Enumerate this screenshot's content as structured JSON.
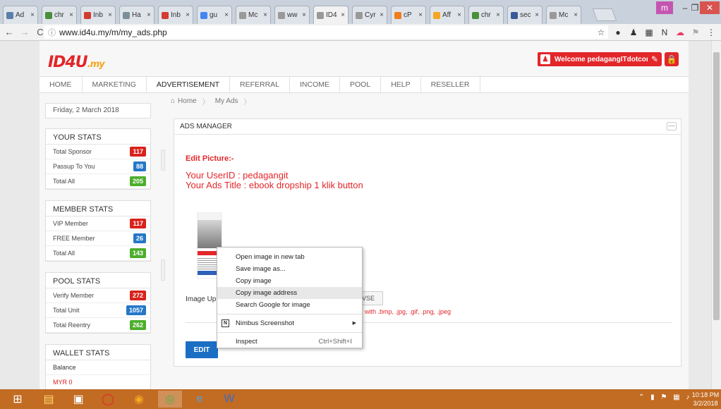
{
  "browser": {
    "tabs": [
      {
        "label": "Ad",
        "color": "#5a7fa8"
      },
      {
        "label": "chr",
        "color": "#4a8f3a"
      },
      {
        "label": "Inb",
        "color": "#d33b2f"
      },
      {
        "label": "Ha",
        "color": "#7b8f9a"
      },
      {
        "label": "Inb",
        "color": "#d33b2f"
      },
      {
        "label": "gu",
        "color": "#4285f4"
      },
      {
        "label": "Mc",
        "color": "#999999"
      },
      {
        "label": "ww",
        "color": "#999999"
      },
      {
        "label": "ID4",
        "color": "#999999",
        "active": true
      },
      {
        "label": "Cyr",
        "color": "#999999"
      },
      {
        "label": "cP",
        "color": "#f07d1a"
      },
      {
        "label": "Aff",
        "color": "#f5a623"
      },
      {
        "label": "chr",
        "color": "#4a8f3a"
      },
      {
        "label": "sec",
        "color": "#3b5998"
      },
      {
        "label": "Mc",
        "color": "#999999"
      }
    ],
    "url": "www.id4u.my/m/my_ads.php"
  },
  "header": {
    "logo_main": "ID4U",
    "logo_suffix": ".my",
    "welcome": "Welcome pedagangITdotcom"
  },
  "nav": {
    "items": [
      "HOME",
      "MARKETING",
      "ADVERTISEMENT",
      "REFERRAL",
      "INCOME",
      "POOL",
      "HELP",
      "RESELLER"
    ],
    "active": "ADVERTISEMENT"
  },
  "breadcrumb": {
    "home": "Home",
    "current": "My Ads"
  },
  "sidebar": {
    "date": "Friday, 2 March 2018",
    "your_stats": {
      "title": "YOUR STATS",
      "rows": [
        {
          "label": "Total Sponsor",
          "value": "117",
          "color": "red"
        },
        {
          "label": "Passup To You",
          "value": "88",
          "color": "blue"
        },
        {
          "label": "Total All",
          "value": "205",
          "color": "green"
        }
      ]
    },
    "member_stats": {
      "title": "MEMBER STATS",
      "rows": [
        {
          "label": "VIP Member",
          "value": "117",
          "color": "red"
        },
        {
          "label": "FREE Member",
          "value": "26",
          "color": "blue"
        },
        {
          "label": "Total All",
          "value": "143",
          "color": "green"
        }
      ]
    },
    "pool_stats": {
      "title": "POOL STATS",
      "rows": [
        {
          "label": "Verify Member",
          "value": "272",
          "color": "red"
        },
        {
          "label": "Total Unit",
          "value": "1057",
          "color": "blue"
        },
        {
          "label": "Total Reentry",
          "value": "262",
          "color": "green"
        }
      ]
    },
    "wallet_stats": {
      "title": "WALLET STATS",
      "balance_label": "Balance",
      "balance_value": "MYR 0"
    }
  },
  "panel": {
    "title": "ADS MANAGER",
    "edit_heading": "Edit Picture:-",
    "userid_line": "Your UserID : pedagangit",
    "ads_title_line": "Your Ads Title : ebook dropship 1 klik button",
    "upload_label": "Image Uplo",
    "browse_label": "VSE",
    "hint": "with .bmp, .jpg, .gif, .png, .jpeg",
    "edit_button": "EDIT"
  },
  "context_menu": {
    "items": [
      {
        "label": "Open image in new tab"
      },
      {
        "label": "Save image as..."
      },
      {
        "label": "Copy image"
      },
      {
        "label": "Copy image address",
        "highlight": true
      },
      {
        "label": "Search Google for image"
      }
    ],
    "nimbus": "Nimbus Screenshot",
    "inspect": "Inspect",
    "inspect_shortcut": "Ctrl+Shift+I"
  },
  "taskbar": {
    "time": "10:18 PM",
    "date": "3/2/2018"
  }
}
